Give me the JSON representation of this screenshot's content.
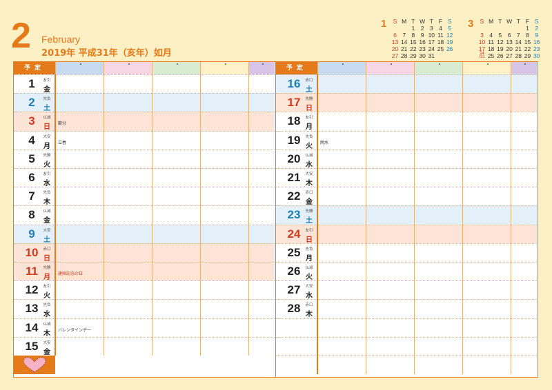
{
  "header": {
    "month_number": "2",
    "month_english": "February",
    "year_line": "2019年 平成31年（亥年）如月"
  },
  "mini_calendars": [
    {
      "month_number": "1",
      "weekday_headers": [
        "S",
        "M",
        "T",
        "W",
        "T",
        "F",
        "S"
      ],
      "weeks": [
        [
          "",
          "",
          "1",
          "2",
          "3",
          "4",
          "5"
        ],
        [
          "6",
          "7",
          "8",
          "9",
          "10",
          "11",
          "12"
        ],
        [
          "13",
          "14",
          "15",
          "16",
          "17",
          "18",
          "19"
        ],
        [
          "20",
          "21",
          "22",
          "23",
          "24",
          "25",
          "26"
        ],
        [
          "27",
          "28",
          "29",
          "30",
          "31",
          "",
          ""
        ]
      ]
    },
    {
      "month_number": "3",
      "weekday_headers": [
        "S",
        "M",
        "T",
        "W",
        "T",
        "F",
        "S"
      ],
      "weeks": [
        [
          "",
          "",
          "",
          "",
          "",
          "1",
          "2"
        ],
        [
          "3",
          "4",
          "5",
          "6",
          "7",
          "8",
          "9"
        ],
        [
          "10",
          "11",
          "12",
          "13",
          "14",
          "15",
          "16"
        ],
        [
          "17",
          "18",
          "19",
          "20",
          "21",
          "22",
          "23"
        ],
        [
          "24/31",
          "25",
          "26",
          "27",
          "28",
          "29",
          "30"
        ]
      ]
    }
  ],
  "yotei_label": "予定",
  "column_colors": [
    "#c7daf0",
    "#f6d6e3",
    "#d7ecd0",
    "#fcf1c9",
    "#d6c5e6"
  ],
  "left_days": [
    {
      "num": "1",
      "rokuyo": "友引",
      "wd": "金",
      "type": "weekday",
      "note": ""
    },
    {
      "num": "2",
      "rokuyo": "先負",
      "wd": "土",
      "type": "sat",
      "note": ""
    },
    {
      "num": "3",
      "rokuyo": "仏滅",
      "wd": "日",
      "type": "sun",
      "note": "節分"
    },
    {
      "num": "4",
      "rokuyo": "大安",
      "wd": "月",
      "type": "weekday",
      "note": "立春"
    },
    {
      "num": "5",
      "rokuyo": "先勝",
      "wd": "火",
      "type": "weekday",
      "note": ""
    },
    {
      "num": "6",
      "rokuyo": "友引",
      "wd": "水",
      "type": "weekday",
      "note": ""
    },
    {
      "num": "7",
      "rokuyo": "先負",
      "wd": "木",
      "type": "weekday",
      "note": ""
    },
    {
      "num": "8",
      "rokuyo": "仏滅",
      "wd": "金",
      "type": "weekday",
      "note": ""
    },
    {
      "num": "9",
      "rokuyo": "大安",
      "wd": "土",
      "type": "sat",
      "note": ""
    },
    {
      "num": "10",
      "rokuyo": "赤口",
      "wd": "日",
      "type": "sun",
      "note": ""
    },
    {
      "num": "11",
      "rokuyo": "先勝",
      "wd": "月",
      "type": "sun",
      "note": "建国記念の日",
      "holiday": true
    },
    {
      "num": "12",
      "rokuyo": "友引",
      "wd": "火",
      "type": "weekday",
      "note": ""
    },
    {
      "num": "13",
      "rokuyo": "先負",
      "wd": "水",
      "type": "weekday",
      "note": ""
    },
    {
      "num": "14",
      "rokuyo": "仏滅",
      "wd": "木",
      "type": "weekday",
      "note": "バレンタインデー"
    },
    {
      "num": "15",
      "rokuyo": "大安",
      "wd": "金",
      "type": "weekday",
      "note": ""
    }
  ],
  "right_days": [
    {
      "num": "16",
      "rokuyo": "赤口",
      "wd": "土",
      "type": "sat",
      "note": ""
    },
    {
      "num": "17",
      "rokuyo": "先勝",
      "wd": "日",
      "type": "sun",
      "note": ""
    },
    {
      "num": "18",
      "rokuyo": "友引",
      "wd": "月",
      "type": "weekday",
      "note": ""
    },
    {
      "num": "19",
      "rokuyo": "先負",
      "wd": "火",
      "type": "weekday",
      "note": "雨水"
    },
    {
      "num": "20",
      "rokuyo": "仏滅",
      "wd": "水",
      "type": "weekday",
      "note": ""
    },
    {
      "num": "21",
      "rokuyo": "大安",
      "wd": "木",
      "type": "weekday",
      "note": ""
    },
    {
      "num": "22",
      "rokuyo": "赤口",
      "wd": "金",
      "type": "weekday",
      "note": ""
    },
    {
      "num": "23",
      "rokuyo": "先勝",
      "wd": "土",
      "type": "sat",
      "note": ""
    },
    {
      "num": "24",
      "rokuyo": "友引",
      "wd": "日",
      "type": "sun",
      "note": ""
    },
    {
      "num": "25",
      "rokuyo": "先負",
      "wd": "月",
      "type": "weekday",
      "note": ""
    },
    {
      "num": "26",
      "rokuyo": "仏滅",
      "wd": "火",
      "type": "weekday",
      "note": ""
    },
    {
      "num": "27",
      "rokuyo": "大安",
      "wd": "水",
      "type": "weekday",
      "note": ""
    },
    {
      "num": "28",
      "rokuyo": "赤口",
      "wd": "木",
      "type": "weekday",
      "note": ""
    }
  ],
  "heart_icon": "heart-icon"
}
